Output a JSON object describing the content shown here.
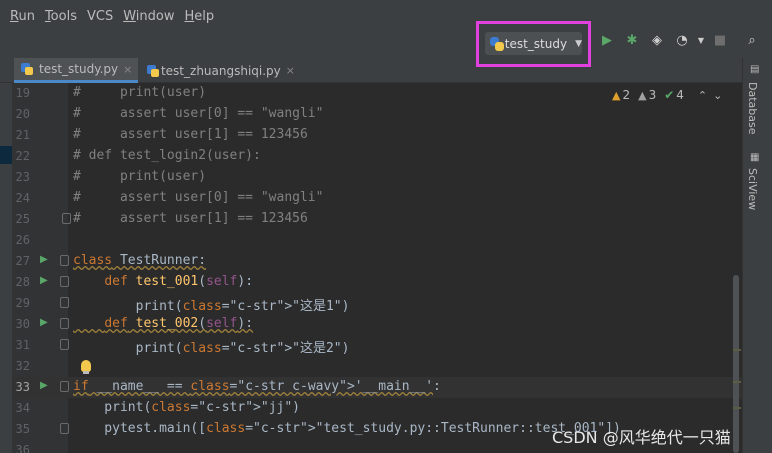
{
  "menu": [
    {
      "label": "Run",
      "underline": "R",
      "rest": "un"
    },
    {
      "label": "Tools",
      "underline": "T",
      "rest": "ools"
    },
    {
      "label": "VCS",
      "underline": "",
      "rest": "VCS"
    },
    {
      "label": "Window",
      "underline": "W",
      "rest": "indow"
    },
    {
      "label": "Help",
      "underline": "H",
      "rest": "elp"
    }
  ],
  "toolbar": {
    "run_config": "test_study",
    "icons": [
      "run-icon",
      "debug-icon",
      "coverage-icon",
      "profile-icon",
      "stop-icon",
      "search-icon"
    ]
  },
  "tabs": [
    {
      "label": "test_study.py",
      "active": true
    },
    {
      "label": "test_zhuangshiqi.py",
      "active": false
    }
  ],
  "side_panel": {
    "database": "Database",
    "sciview": "SciView"
  },
  "inspections": {
    "warnings": "2",
    "weak_warnings": "3",
    "ok": "4"
  },
  "lines": [
    {
      "n": "19",
      "text": "#     print(user)"
    },
    {
      "n": "20",
      "text": "#     assert user[0] == \"wangli\""
    },
    {
      "n": "21",
      "text": "#     assert user[1] == 123456"
    },
    {
      "n": "22",
      "text": "# def test_login2(user):"
    },
    {
      "n": "23",
      "text": "#     print(user)"
    },
    {
      "n": "24",
      "text": "#     assert user[0] == \"wangli\""
    },
    {
      "n": "25",
      "text": "#     assert user[1] == 123456"
    },
    {
      "n": "26",
      "text": ""
    },
    {
      "n": "27",
      "text": "class TestRunner:"
    },
    {
      "n": "28",
      "text": "    def test_001(self):"
    },
    {
      "n": "29",
      "text": "        print(\"这是1\")"
    },
    {
      "n": "30",
      "text": "    def test_002(self):"
    },
    {
      "n": "31",
      "text": "        print(\"这是2\")"
    },
    {
      "n": "32",
      "text": ""
    },
    {
      "n": "33",
      "text": "if __name__ == '__main__':"
    },
    {
      "n": "34",
      "text": "    print(\"jj\")"
    },
    {
      "n": "35",
      "text": "    pytest.main([\"test_study.py::TestRunner::test_001\"])"
    },
    {
      "n": "36",
      "text": ""
    }
  ],
  "watermark": "CSDN @风华绝代一只猫",
  "colors": {
    "highlight_border": "#e040e0",
    "run_green": "#59a869",
    "keyword": "#cc7832",
    "string": "#6a8759"
  }
}
